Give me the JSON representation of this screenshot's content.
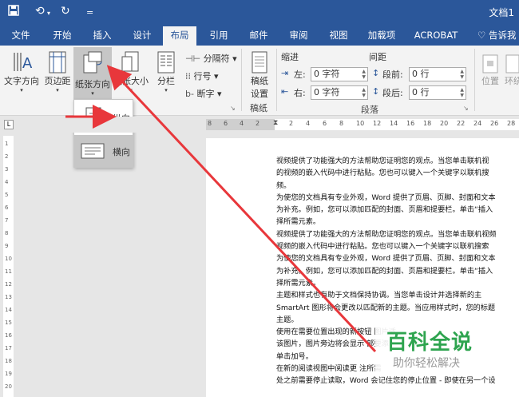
{
  "quick_access": {
    "save_icon": "save-icon",
    "undo_icon": "undo-icon",
    "redo_icon": "redo-icon",
    "customize": "="
  },
  "window": {
    "title": "文档1"
  },
  "tabs": [
    "文件",
    "开始",
    "插入",
    "设计",
    "布局",
    "引用",
    "邮件",
    "审阅",
    "视图",
    "加载项",
    "ACROBAT",
    "告诉我"
  ],
  "active_tab": "布局",
  "ribbon": {
    "text_direction": "文字方向",
    "margins": "页边距",
    "orientation": "纸张方向",
    "size": "纸张大小",
    "columns": "分栏",
    "breaks": "分隔符",
    "line_numbers": "行号",
    "hyphenation": "断字",
    "draft_paper": [
      "稿纸",
      "设置"
    ],
    "draft_group": "稿纸",
    "indent_header": "缩进",
    "spacing_header": "间距",
    "indent_left_label": "左:",
    "indent_left_value": "0 字符",
    "indent_right_label": "右:",
    "indent_right_value": "0 字符",
    "space_before_label": "段前:",
    "space_before_value": "0 行",
    "space_after_label": "段后:",
    "space_after_value": "0 行",
    "paragraph_group": "段落",
    "position": "位置",
    "wrap": "环绕"
  },
  "orientation_menu": {
    "portrait": "纵向",
    "landscape": "横向"
  },
  "ruler": {
    "neg_ticks": [
      "8",
      "6",
      "4",
      "2"
    ],
    "ticks": [
      "2",
      "4",
      "6",
      "8",
      "10",
      "12",
      "14",
      "16",
      "18",
      "20",
      "22",
      "24",
      "26",
      "28"
    ]
  },
  "vruler_numbers": [
    "1",
    "2",
    "3",
    "4",
    "5",
    "6",
    "7",
    "8",
    "9",
    "10",
    "11",
    "12",
    "13",
    "14",
    "15",
    "16",
    "17",
    "18",
    "19",
    "20"
  ],
  "document_lines": [
    "视频提供了功能强大的方法帮助您证明您的观点。当您单击联机视",
    "的视频的嵌入代码中进行粘贴。您也可以键入一个关键字以联机搜",
    "频。",
    "为使您的文档具有专业外观，Word 提供了页眉、页脚、封面和文本",
    "为补充。例如，您可以添加匹配的封面、页眉和提要栏。单击“插入",
    "择所需元素。",
    "视频提供了功能强大的方法帮助您证明您的观点。当您单击联机视频",
    "视频的嵌入代码中进行粘贴。您也可以键入一个关键字以联机搜索",
    "为使您的文档具有专业外观，Word 提供了页眉、页脚、封面和文本",
    "为补充。例如，您可以添加匹配的封面、页眉和提要栏。单击“插入",
    "择所需元素。",
    "主题和样式也有助于文档保持协调。当您单击设计并选择新的主",
    "SmartArt 图形将会更改以匹配新的主题。当应用样式时，您的标题",
    "主题。",
    "使用在需要位置出现的新按钮                          图片适",
    "该图片，图片旁边将会显示                            部要添",
    "单击加号。",
    "在新的阅读视图中阅读更                              注所需",
    "处之前需要停止读取，Word 会记住您的停止位置 - 即使在另一个设"
  ],
  "watermark": {
    "title": "百科全说",
    "subtitle": "助你轻松解决"
  },
  "colors": {
    "brand": "#2b579a",
    "ribbon_bg": "#f3f3f3",
    "arrow": "#e8373b",
    "watermark_green": "#2ea44f"
  }
}
